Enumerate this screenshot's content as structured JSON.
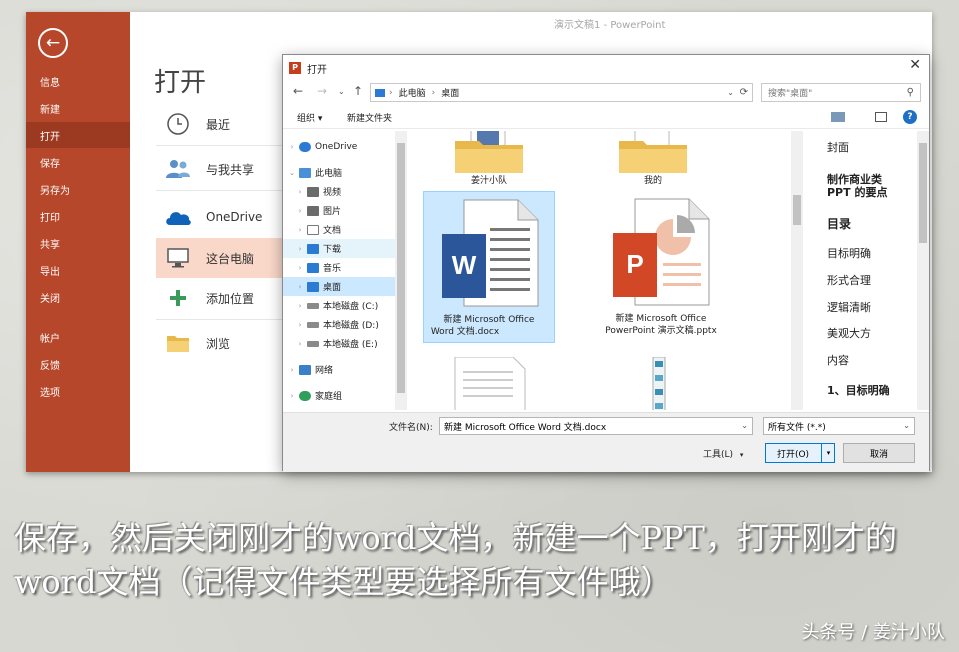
{
  "app_title": "演示文稿1  -  PowerPoint",
  "sidebar": {
    "items": [
      {
        "label": "信息",
        "active": false
      },
      {
        "label": "新建",
        "active": false
      },
      {
        "label": "打开",
        "active": true
      },
      {
        "label": "保存",
        "active": false
      },
      {
        "label": "另存为",
        "active": false
      },
      {
        "label": "打印",
        "active": false
      },
      {
        "label": "共享",
        "active": false
      },
      {
        "label": "导出",
        "active": false
      },
      {
        "label": "关闭",
        "active": false
      },
      {
        "label": "帐户",
        "active": false
      },
      {
        "label": "反馈",
        "active": false
      },
      {
        "label": "选项",
        "active": false
      }
    ]
  },
  "main": {
    "heading": "打开",
    "locations": [
      {
        "label": "最近",
        "icon": "clock-icon"
      },
      {
        "label": "与我共享",
        "icon": "people-icon"
      },
      {
        "label": "OneDrive",
        "icon": "cloud-icon"
      },
      {
        "label": "这台电脑",
        "icon": "computer-icon",
        "selected": true
      },
      {
        "label": "添加位置",
        "icon": "plus-icon"
      },
      {
        "label": "浏览",
        "icon": "folder-icon"
      }
    ]
  },
  "dialog": {
    "title": "打开",
    "breadcrumb": [
      "此电脑",
      "桌面"
    ],
    "search_placeholder": "搜索\"桌面\"",
    "toolbar": {
      "organize": "组织 ▾",
      "new_folder": "新建文件夹"
    },
    "tree": [
      {
        "label": "OneDrive",
        "level": 0,
        "color": "#2b7bd4"
      },
      {
        "label": "此电脑",
        "level": 0,
        "color": "#4a90d9",
        "expanded": true
      },
      {
        "label": "视频",
        "level": 1,
        "color": "#6b6b6b"
      },
      {
        "label": "图片",
        "level": 1,
        "color": "#6b6b6b"
      },
      {
        "label": "文档",
        "level": 1,
        "color": "#7a7a7a"
      },
      {
        "label": "下载",
        "level": 1,
        "color": "#2b7bd4",
        "highlight": true
      },
      {
        "label": "音乐",
        "level": 1,
        "color": "#2b7bd4"
      },
      {
        "label": "桌面",
        "level": 1,
        "color": "#2b7bd4",
        "selected": true
      },
      {
        "label": "本地磁盘 (C:)",
        "level": 1,
        "color": "#8a8a8a"
      },
      {
        "label": "本地磁盘 (D:)",
        "level": 1,
        "color": "#8a8a8a"
      },
      {
        "label": "本地磁盘 (E:)",
        "level": 1,
        "color": "#8a8a8a"
      },
      {
        "label": "网络",
        "level": 0,
        "color": "#3a7fc9"
      },
      {
        "label": "家庭组",
        "level": 0,
        "color": "#2e9e5a"
      }
    ],
    "files": [
      {
        "label": "姜汁小队"
      },
      {
        "label": "我的"
      },
      {
        "label": "新建 Microsoft Office Word 文档.docx",
        "label_line1": "新建 Microsoft Office",
        "label_line2": "Word 文档.docx"
      },
      {
        "label": "新建 Microsoft Office PowerPoint 演示文稿.pptx",
        "label_line1": "新建 Microsoft Office",
        "label_line2": "PowerPoint 演示文稿.pptx"
      }
    ],
    "preview": [
      "封面",
      "制作商业类",
      "PPT 的要点",
      "目录",
      "目标明确",
      "形式合理",
      "逻辑清晰",
      "美观大方",
      "内容",
      "1、目标明确"
    ],
    "file_name_label": "文件名(N):",
    "file_name_value": "新建 Microsoft Office Word 文档.docx",
    "file_type_value": "所有文件 (*.*)",
    "tools_label": "工具(L)",
    "open_label": "打开(O)",
    "cancel_label": "取消"
  },
  "caption": "保存，然后关闭刚才的word文档，新建一个PPT，打开刚才的word文档（记得文件类型要选择所有文件哦）",
  "watermark": "头条号 / 姜汁小队",
  "colors": {
    "ppt_red": "#b7472a",
    "ppt_red_dark": "#9c3a21",
    "word_blue": "#2b579a",
    "selection": "#cce8ff"
  }
}
